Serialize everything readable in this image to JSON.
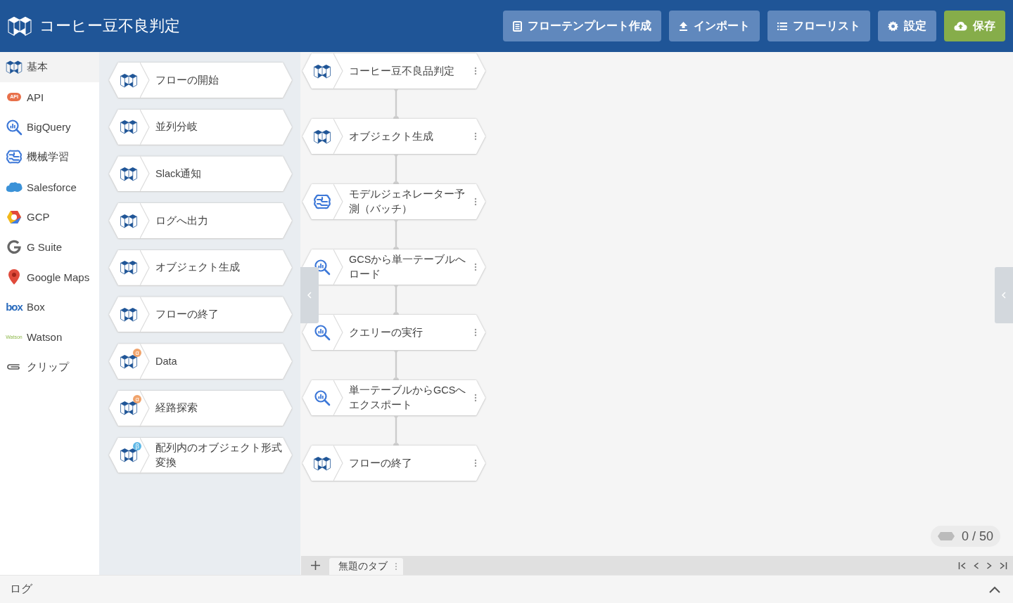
{
  "header": {
    "title": "コーヒー豆不良判定",
    "buttons": [
      {
        "label": "フローテンプレート作成",
        "kind": "template"
      },
      {
        "label": "インポート",
        "kind": "import"
      },
      {
        "label": "フローリスト",
        "kind": "list"
      },
      {
        "label": "設定",
        "kind": "settings"
      },
      {
        "label": "保存",
        "kind": "save"
      }
    ]
  },
  "sidebar": {
    "categories": [
      {
        "label": "基本",
        "kind": "logo",
        "selected": true
      },
      {
        "label": "API",
        "kind": "api",
        "icon_text": "API",
        "selected": false
      },
      {
        "label": "BigQuery",
        "kind": "bigquery",
        "selected": false
      },
      {
        "label": "機械学習",
        "kind": "brain",
        "selected": false
      },
      {
        "label": "Salesforce",
        "kind": "cloud",
        "selected": false
      },
      {
        "label": "GCP",
        "kind": "gcp",
        "selected": false
      },
      {
        "label": "G Suite",
        "kind": "g",
        "selected": false
      },
      {
        "label": "Google Maps",
        "kind": "pin",
        "selected": false
      },
      {
        "label": "Box",
        "kind": "box",
        "icon_text": "box",
        "selected": false
      },
      {
        "label": "Watson",
        "kind": "watson",
        "icon_text": "Watson",
        "selected": false
      },
      {
        "label": "クリップ",
        "kind": "clip",
        "selected": false
      }
    ]
  },
  "palette": {
    "blocks": [
      {
        "label": "フローの開始",
        "kind": "logo"
      },
      {
        "label": "並列分岐",
        "kind": "logo"
      },
      {
        "label": "Slack通知",
        "kind": "logo"
      },
      {
        "label": "ログへ出力",
        "kind": "logo"
      },
      {
        "label": "オブジェクト生成",
        "kind": "logo"
      },
      {
        "label": "フローの終了",
        "kind": "logo"
      },
      {
        "label": "Data",
        "kind": "logo",
        "badge": {
          "text": "α",
          "color": "#f0a36b"
        }
      },
      {
        "label": "経路探索",
        "kind": "logo",
        "badge": {
          "text": "α",
          "color": "#f0a36b"
        }
      },
      {
        "label": "配列内のオブジェクト形式変換",
        "kind": "logo",
        "badge": {
          "text": "β",
          "color": "#5fb8e6"
        }
      }
    ]
  },
  "flow": {
    "nodes": [
      {
        "label": "コーヒー豆不良品判定",
        "kind": "logo"
      },
      {
        "label": "オブジェクト生成",
        "kind": "logo"
      },
      {
        "label": "モデルジェネレーター予測（バッチ）",
        "kind": "brain"
      },
      {
        "label": "GCSから単一テーブルへロード",
        "kind": "bigquery"
      },
      {
        "label": "クエリーの実行",
        "kind": "bigquery"
      },
      {
        "label": "単一テーブルからGCSへエクスポート",
        "kind": "bigquery"
      },
      {
        "label": "フローの終了",
        "kind": "logo"
      }
    ],
    "counter": "0 / 50"
  },
  "tabs": [
    {
      "label": "無題のタブ",
      "selected": true
    }
  ],
  "log_bar": {
    "label": "ログ"
  }
}
